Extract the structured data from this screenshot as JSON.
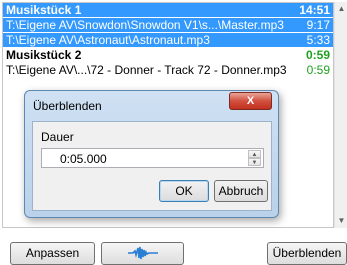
{
  "playlist": {
    "tracks": [
      {
        "title": "Musikstück 1",
        "total": "14:51",
        "files": [
          {
            "path": "T:\\Eigene AV\\Snowdon\\Snowdon V1\\s...\\Master.mp3",
            "time": "9:17"
          },
          {
            "path": "T:\\Eigene AV\\Astronaut\\Astronaut.mp3",
            "time": "5:33"
          }
        ]
      },
      {
        "title": "Musikstück 2",
        "total": "0:59",
        "files": [
          {
            "path": "T:\\Eigene AV\\...\\72 - Donner - Track 72 - Donner.mp3",
            "time": "0:59"
          }
        ]
      }
    ]
  },
  "dialog": {
    "title": "Überblenden",
    "close_label": "X",
    "field_label": "Dauer",
    "field_value": "0:05.000",
    "ok_label": "OK",
    "cancel_label": "Abbruch"
  },
  "bottom": {
    "anpassen_label": "Anpassen",
    "wave_icon": "waveform-icon",
    "ueberblenden_label": "Überblenden"
  },
  "colors": {
    "selection": "#3399ff",
    "green": "#20a020",
    "wave": "#2a7fd4"
  }
}
